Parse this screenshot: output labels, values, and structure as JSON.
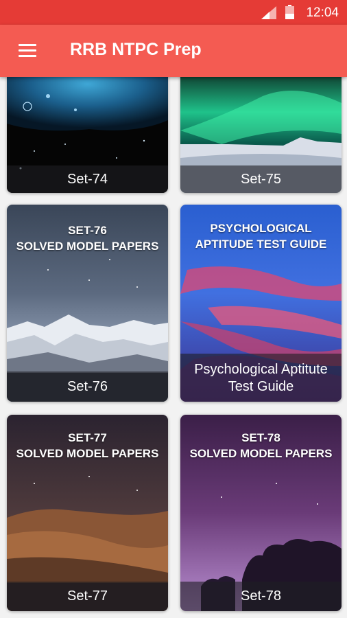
{
  "status": {
    "time": "12:04"
  },
  "appbar": {
    "title": "RRB NTPC Prep"
  },
  "cards": [
    {
      "header_line1": "",
      "header_line2": "",
      "label": "Set-74"
    },
    {
      "header_line1": "",
      "header_line2": "",
      "label": "Set-75"
    },
    {
      "header_line1": "SET-76",
      "header_line2": "SOLVED MODEL PAPERS",
      "label": "Set-76"
    },
    {
      "header_line1": "PSYCHOLOGICAL",
      "header_line2": "APTITUDE TEST GUIDE",
      "label": "Psychological Aptitute Test Guide"
    },
    {
      "header_line1": "SET-77",
      "header_line2": "SOLVED MODEL PAPERS",
      "label": "Set-77"
    },
    {
      "header_line1": "SET-78",
      "header_line2": "SOLVED MODEL PAPERS",
      "label": "Set-78"
    }
  ],
  "colors": {
    "statusbar": "#e53b36",
    "appbar": "#f45b52"
  }
}
